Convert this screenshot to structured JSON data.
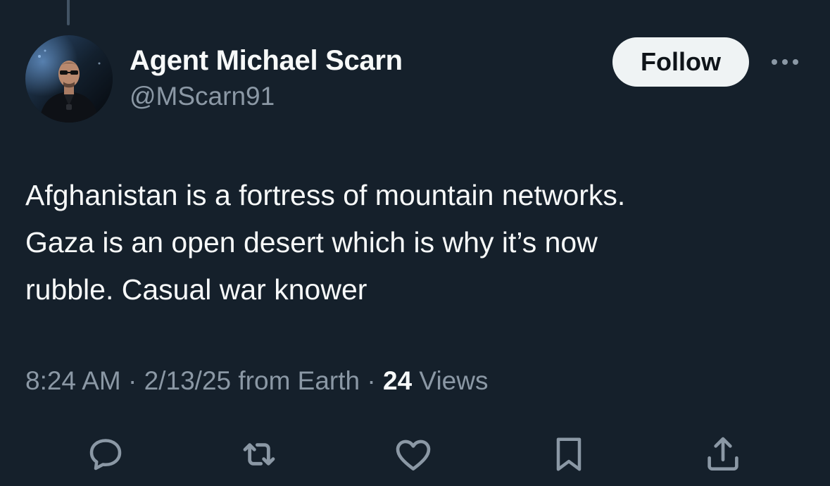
{
  "author": {
    "display_name": "Agent Michael Scarn",
    "handle": "@MScarn91"
  },
  "follow_label": "Follow",
  "tweet": {
    "lines": [
      "Afghanistan is a fortress of mountain networks.",
      "Gaza is an open desert which is why it’s now",
      "rubble. Casual war knower"
    ]
  },
  "meta": {
    "time": "8:24 AM",
    "sep1": " · ",
    "date": "2/13/25",
    "location": " from Earth",
    "sep2": " · ",
    "views_count": "24",
    "views_label": " Views"
  },
  "actions": [
    {
      "name": "reply",
      "icon": "speech-bubble-icon"
    },
    {
      "name": "repost",
      "icon": "repost-arrows-icon"
    },
    {
      "name": "like",
      "icon": "heart-icon"
    },
    {
      "name": "bookmark",
      "icon": "bookmark-icon"
    },
    {
      "name": "share",
      "icon": "share-upload-icon"
    }
  ],
  "colors": {
    "background": "#15202b",
    "primary_text": "#f7f9f9",
    "secondary_text": "#8b98a5",
    "follow_button_bg": "#eff3f4",
    "thread_line": "#425364"
  }
}
